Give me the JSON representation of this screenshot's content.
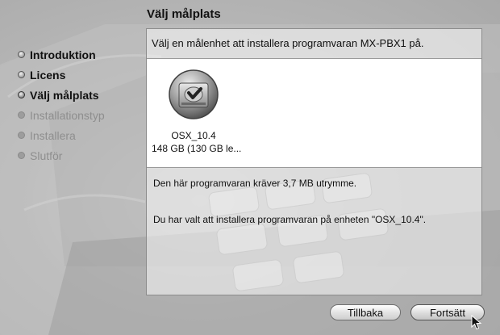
{
  "page_title": "Välj målplats",
  "sidebar": {
    "steps": [
      {
        "label": "Introduktion",
        "state": "done"
      },
      {
        "label": "Licens",
        "state": "done"
      },
      {
        "label": "Välj målplats",
        "state": "current"
      },
      {
        "label": "Installationstyp",
        "state": "pending"
      },
      {
        "label": "Installera",
        "state": "pending"
      },
      {
        "label": "Slutför",
        "state": "pending"
      }
    ]
  },
  "main": {
    "instruction": "Välj en målenhet att installera programvaran MX-PBX1 på.",
    "disk": {
      "icon": "hard-disk-icon",
      "name": "OSX_10.4",
      "size": "148 GB (130 GB le..."
    },
    "info_required": "Den här programvaran kräver 3,7 MB utrymme.",
    "info_selected": "Du har valt att installera programvaran på enheten \"OSX_10.4\"."
  },
  "buttons": {
    "back": "Tillbaka",
    "continue": "Fortsätt"
  }
}
